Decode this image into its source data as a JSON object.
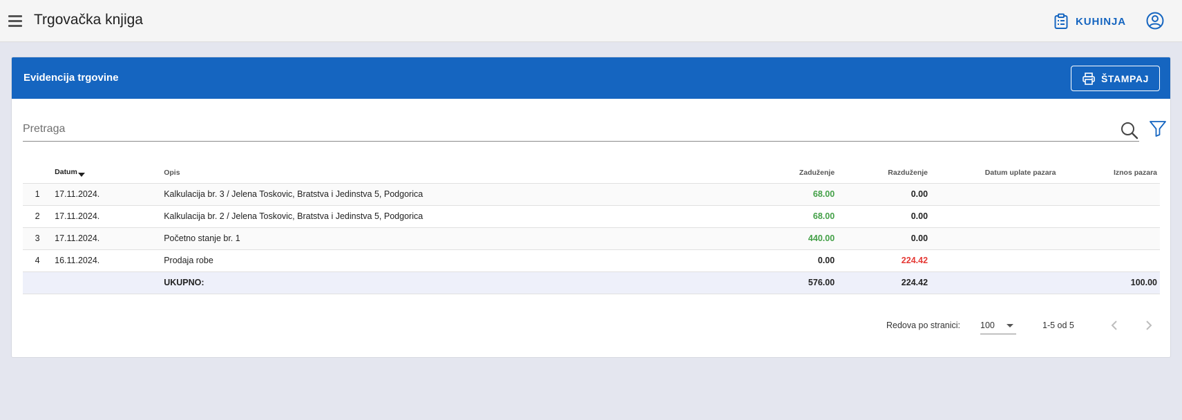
{
  "appbar": {
    "title": "Trgovačka knjiga",
    "kitchen_label": "KUHINJA",
    "icons": {
      "menu": "hamburger-menu-icon",
      "kitchen": "clipboard-list-icon",
      "account": "account-circle-icon"
    }
  },
  "card": {
    "title": "Evidencija trgovine",
    "print_label": "ŠTAMPAJ",
    "accent": "#1565c0"
  },
  "search": {
    "placeholder": "Pretraga"
  },
  "table": {
    "headers": {
      "index": "",
      "datum": "Datum",
      "opis": "Opis",
      "zaduzenje": "Zaduženje",
      "razduzenje": "Razduženje",
      "datum_uplate": "Datum uplate pazara",
      "iznos_pazara": "Iznos pazara"
    },
    "rows": [
      {
        "index": "1",
        "datum": "17.11.2024.",
        "opis": "Kalkulacija br. 3 / Jelena Toskovic, Bratstva i Jedinstva 5, Podgorica",
        "zaduzenje": "68.00",
        "razduzenje": "0.00",
        "datum_uplate": "",
        "iznos_pazara": ""
      },
      {
        "index": "2",
        "datum": "17.11.2024.",
        "opis": "Kalkulacija br. 2 / Jelena Toskovic, Bratstva i Jedinstva 5, Podgorica",
        "zaduzenje": "68.00",
        "razduzenje": "0.00",
        "datum_uplate": "",
        "iznos_pazara": ""
      },
      {
        "index": "3",
        "datum": "17.11.2024.",
        "opis": "Početno stanje br. 1",
        "zaduzenje": "440.00",
        "razduzenje": "0.00",
        "datum_uplate": "",
        "iznos_pazara": ""
      },
      {
        "index": "4",
        "datum": "16.11.2024.",
        "opis": "Prodaja robe",
        "zaduzenje": "0.00",
        "razduzenje": "224.42",
        "datum_uplate": "",
        "iznos_pazara": ""
      }
    ],
    "total": {
      "label": "UKUPNO:",
      "zaduzenje": "576.00",
      "razduzenje": "224.42",
      "iznos_pazara": "100.00"
    },
    "colors": {
      "positive": "#43a047",
      "negative": "#e53935"
    }
  },
  "pagination": {
    "rows_per_page_label": "Redova po stranici:",
    "rows_per_page": "100",
    "range": "1-5 od 5"
  }
}
